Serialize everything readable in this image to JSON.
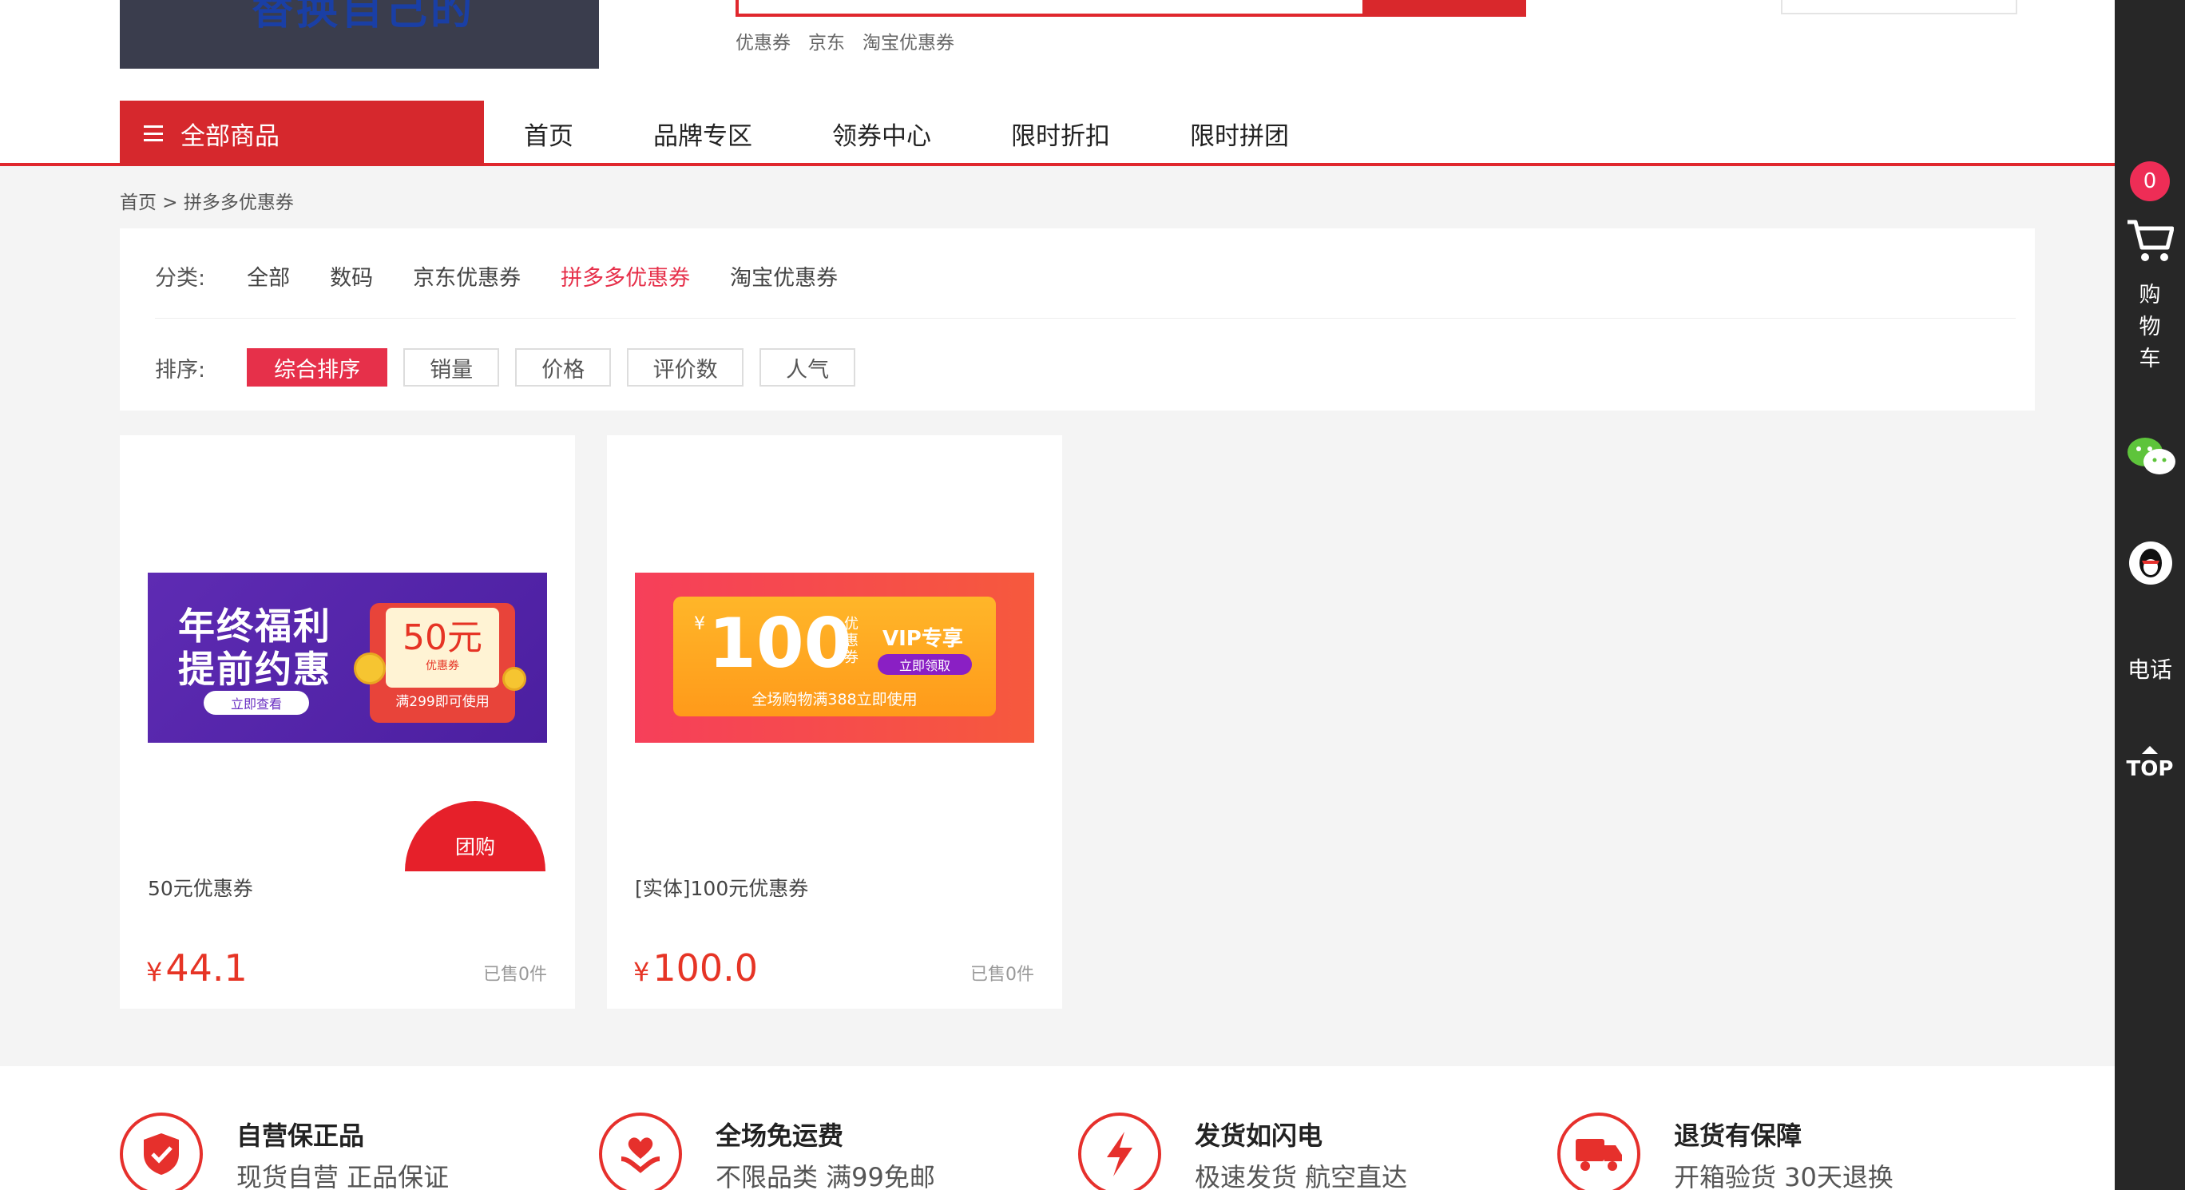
{
  "header": {
    "logo_text": "替换自己的",
    "hot_words": [
      "优惠券",
      "京东",
      "淘宝优惠券"
    ]
  },
  "nav": {
    "all_categories": "全部商品",
    "items": [
      "首页",
      "品牌专区",
      "领券中心",
      "限时折扣",
      "限时拼团"
    ]
  },
  "breadcrumb": "首页 > 拼多多优惠券",
  "filter": {
    "category_label": "分类:",
    "categories": [
      {
        "label": "全部",
        "active": false
      },
      {
        "label": "数码",
        "active": false
      },
      {
        "label": "京东优惠券",
        "active": false
      },
      {
        "label": "拼多多优惠券",
        "active": true
      },
      {
        "label": "淘宝优惠券",
        "active": false
      }
    ],
    "sort_label": "排序:",
    "sorts": [
      {
        "label": "综合排序",
        "active": true
      },
      {
        "label": "销量",
        "active": false
      },
      {
        "label": "价格",
        "active": false
      },
      {
        "label": "评价数",
        "active": false
      },
      {
        "label": "人气",
        "active": false
      }
    ]
  },
  "products": [
    {
      "title": "50元优惠券",
      "currency": "¥",
      "price": "44.1",
      "sold": "已售0件",
      "badge": "团购",
      "banner": {
        "title_line1": "年终福利",
        "title_line2": "提前约惠",
        "button": "立即查看",
        "amount": "50元",
        "amount_sub": "优惠券",
        "condition": "满299即可使用"
      }
    },
    {
      "title": "[实体]100元优惠券",
      "currency": "¥",
      "price": "100.0",
      "sold": "已售0件",
      "banner": {
        "yen": "¥",
        "amount": "100",
        "unit": "优惠券",
        "vip": "VIP专享",
        "button": "立即领取",
        "condition": "全场购物满388立即使用"
      }
    }
  ],
  "footer": {
    "features": [
      {
        "title": "自营保正品",
        "subtitle": "现货自营 正品保证",
        "icon": "shield-check-icon"
      },
      {
        "title": "全场免运费",
        "subtitle": "不限品类 满99免邮",
        "icon": "heart-hands-icon"
      },
      {
        "title": "发货如闪电",
        "subtitle": "极速发货 航空直达",
        "icon": "lightning-icon"
      },
      {
        "title": "退货有保障",
        "subtitle": "开箱验货 30天退换",
        "icon": "truck-icon"
      }
    ]
  },
  "sidebar": {
    "cart_count": "0",
    "cart_label": "购物车",
    "phone_label": "电话",
    "top_label": "TOP"
  },
  "colors": {
    "brand_red": "#d6282d",
    "active_pink": "#e6304a",
    "price_red": "#e63425",
    "sidebar_bg": "#272727"
  }
}
